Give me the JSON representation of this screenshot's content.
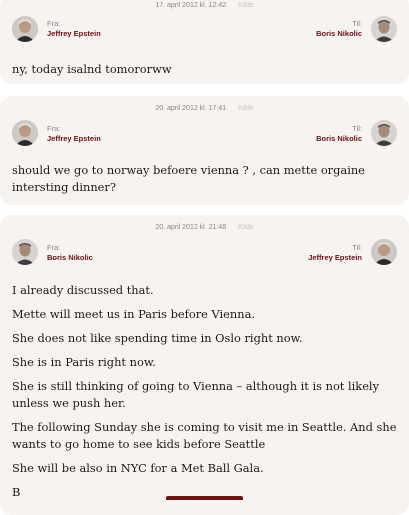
{
  "messages": [
    {
      "timestamp": "17. april 2012 kl. 12:42",
      "source_label": "Kilde",
      "from_label": "Fra:",
      "from_name": "Jeffrey Epstein",
      "to_label": "Til:",
      "to_name": "Boris Nikolic",
      "paragraphs": [
        "ny, today isalnd tomororww"
      ]
    },
    {
      "timestamp": "20. april 2012 kl. 17:41",
      "source_label": "Kilde",
      "from_label": "Fra:",
      "from_name": "Jeffrey Epstein",
      "to_label": "Til:",
      "to_name": "Boris Nikolic",
      "paragraphs": [
        "should we go to norway befoere vienna ? , can mette orgaine intersting dinner?"
      ]
    },
    {
      "timestamp": "20. april 2012 kl. 21:48",
      "source_label": "Kilde",
      "from_label": "Fra:",
      "from_name": "Boris Nikolic",
      "to_label": "Til:",
      "to_name": "Jeffrey Epstein",
      "paragraphs": [
        "I already discussed that.",
        "Mette will meet us in Paris before Vienna.",
        "She does not like spending time in Oslo right now.",
        "She is in Paris right now.",
        "She is still thinking of going to Vienna – although it is not likely unless we push her.",
        "The following Sunday she is coming to visit me in Seattle. And she wants to go home to see kids before Seattle",
        "She will be also in NYC for a Met Ball Gala.",
        "B"
      ]
    }
  ],
  "colors": {
    "card_bg": "#f7f3f1",
    "name_color": "#6b1414",
    "meta_color": "#8c8683",
    "scroll_indicator": "#6b1414"
  }
}
